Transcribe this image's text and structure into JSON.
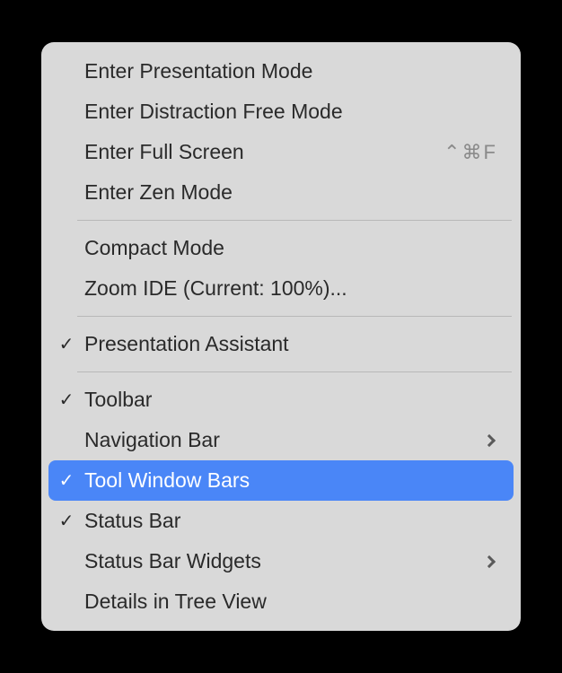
{
  "menu": {
    "groups": [
      {
        "items": [
          {
            "label": "Enter Presentation Mode",
            "checked": false,
            "shortcut": "",
            "submenu": false,
            "highlighted": false,
            "name": "enter-presentation-mode"
          },
          {
            "label": "Enter Distraction Free Mode",
            "checked": false,
            "shortcut": "",
            "submenu": false,
            "highlighted": false,
            "name": "enter-distraction-free-mode"
          },
          {
            "label": "Enter Full Screen",
            "checked": false,
            "shortcut": "⌃⌘F",
            "submenu": false,
            "highlighted": false,
            "name": "enter-full-screen"
          },
          {
            "label": "Enter Zen Mode",
            "checked": false,
            "shortcut": "",
            "submenu": false,
            "highlighted": false,
            "name": "enter-zen-mode"
          }
        ]
      },
      {
        "items": [
          {
            "label": "Compact Mode",
            "checked": false,
            "shortcut": "",
            "submenu": false,
            "highlighted": false,
            "name": "compact-mode"
          },
          {
            "label": "Zoom IDE (Current: 100%)...",
            "checked": false,
            "shortcut": "",
            "submenu": false,
            "highlighted": false,
            "name": "zoom-ide"
          }
        ]
      },
      {
        "items": [
          {
            "label": "Presentation Assistant",
            "checked": true,
            "shortcut": "",
            "submenu": false,
            "highlighted": false,
            "name": "presentation-assistant"
          }
        ]
      },
      {
        "items": [
          {
            "label": "Toolbar",
            "checked": true,
            "shortcut": "",
            "submenu": false,
            "highlighted": false,
            "name": "toolbar"
          },
          {
            "label": "Navigation Bar",
            "checked": false,
            "shortcut": "",
            "submenu": true,
            "highlighted": false,
            "name": "navigation-bar"
          },
          {
            "label": "Tool Window Bars",
            "checked": true,
            "shortcut": "",
            "submenu": false,
            "highlighted": true,
            "name": "tool-window-bars"
          },
          {
            "label": "Status Bar",
            "checked": true,
            "shortcut": "",
            "submenu": false,
            "highlighted": false,
            "name": "status-bar"
          },
          {
            "label": "Status Bar Widgets",
            "checked": false,
            "shortcut": "",
            "submenu": true,
            "highlighted": false,
            "name": "status-bar-widgets"
          },
          {
            "label": "Details in Tree View",
            "checked": false,
            "shortcut": "",
            "submenu": false,
            "highlighted": false,
            "name": "details-in-tree-view"
          }
        ]
      }
    ]
  },
  "checkmark_glyph": "✓"
}
